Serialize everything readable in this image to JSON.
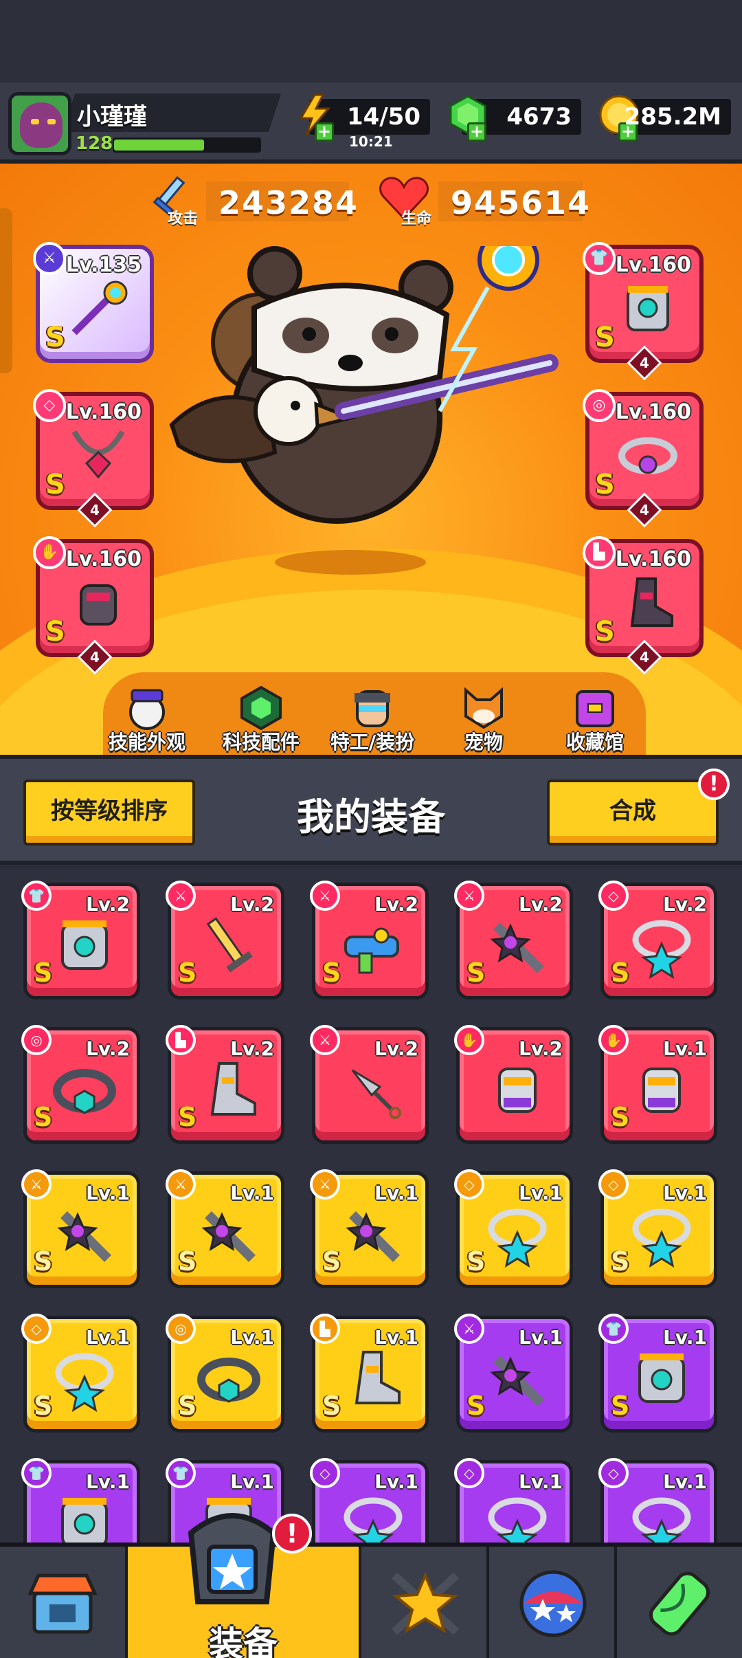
{
  "player": {
    "name": "小瑾瑾",
    "level": "128",
    "xp_fraction": 0.62
  },
  "resources": {
    "energy": "14/50",
    "energy_timer": "10:21",
    "gems": "4673",
    "coins": "285.2M"
  },
  "stats": {
    "attack_label": "攻击",
    "attack_value": "243284",
    "hp_label": "生命",
    "hp_value": "945614"
  },
  "equipped": {
    "left": [
      {
        "level": "Lv.135",
        "grade": "S",
        "stars": null,
        "icon": "weapon-staff-icon"
      },
      {
        "level": "Lv.160",
        "grade": "S",
        "stars": "4",
        "icon": "necklace-icon"
      },
      {
        "level": "Lv.160",
        "grade": "S",
        "stars": "4",
        "icon": "glove-icon"
      }
    ],
    "right": [
      {
        "level": "Lv.160",
        "grade": "S",
        "stars": "4",
        "icon": "armor-icon"
      },
      {
        "level": "Lv.160",
        "grade": "S",
        "stars": "4",
        "icon": "belt-icon"
      },
      {
        "level": "Lv.160",
        "grade": "S",
        "stars": "4",
        "icon": "boot-icon"
      }
    ]
  },
  "hero_menu": [
    {
      "label": "技能外观",
      "icon": "skill-skin-icon"
    },
    {
      "label": "科技配件",
      "icon": "tech-part-icon"
    },
    {
      "label": "特工/装扮",
      "icon": "agent-outfit-icon"
    },
    {
      "label": "宠物",
      "icon": "pet-icon"
    },
    {
      "label": "收藏馆",
      "icon": "collection-icon"
    }
  ],
  "equipment_panel": {
    "sort_label": "按等级排序",
    "title": "我的装备",
    "merge_label": "合成",
    "alert": "!"
  },
  "inventory": [
    {
      "level": "Lv.2",
      "grade": "S",
      "rarity": "red",
      "icon": "armor-icon"
    },
    {
      "level": "Lv.2",
      "grade": "S",
      "rarity": "red",
      "icon": "sword-icon"
    },
    {
      "level": "Lv.2",
      "grade": "S",
      "rarity": "red",
      "icon": "water-gun-icon"
    },
    {
      "level": "Lv.2",
      "grade": "S",
      "rarity": "red",
      "icon": "shuriken-blade-icon"
    },
    {
      "level": "Lv.2",
      "grade": "S",
      "rarity": "red",
      "icon": "necklace-icon"
    },
    {
      "level": "Lv.2",
      "grade": "S",
      "rarity": "red",
      "icon": "belt-icon"
    },
    {
      "level": "Lv.2",
      "grade": "S",
      "rarity": "red",
      "icon": "boot-icon"
    },
    {
      "level": "Lv.2",
      "grade": "",
      "rarity": "red",
      "icon": "kunai-icon"
    },
    {
      "level": "Lv.2",
      "grade": "",
      "rarity": "red",
      "icon": "glove-icon"
    },
    {
      "level": "Lv.1",
      "grade": "S",
      "rarity": "red",
      "icon": "glove-icon"
    },
    {
      "level": "Lv.1",
      "grade": "S",
      "rarity": "yellow",
      "icon": "shuriken-blade-icon"
    },
    {
      "level": "Lv.1",
      "grade": "S",
      "rarity": "yellow",
      "icon": "shuriken-blade-icon"
    },
    {
      "level": "Lv.1",
      "grade": "S",
      "rarity": "yellow",
      "icon": "shuriken-blade-icon"
    },
    {
      "level": "Lv.1",
      "grade": "S",
      "rarity": "yellow",
      "icon": "necklace-icon"
    },
    {
      "level": "Lv.1",
      "grade": "S",
      "rarity": "yellow",
      "icon": "necklace-icon"
    },
    {
      "level": "Lv.1",
      "grade": "S",
      "rarity": "yellow",
      "icon": "necklace-icon"
    },
    {
      "level": "Lv.1",
      "grade": "S",
      "rarity": "yellow",
      "icon": "belt-icon"
    },
    {
      "level": "Lv.1",
      "grade": "S",
      "rarity": "yellow",
      "icon": "boot-icon"
    },
    {
      "level": "Lv.1",
      "grade": "S",
      "rarity": "purple",
      "icon": "shuriken-blade-icon"
    },
    {
      "level": "Lv.1",
      "grade": "S",
      "rarity": "purple",
      "icon": "armor-icon"
    },
    {
      "level": "Lv.1",
      "grade": "",
      "rarity": "purple",
      "icon": "armor-icon"
    },
    {
      "level": "Lv.1",
      "grade": "",
      "rarity": "purple",
      "icon": "armor-icon"
    },
    {
      "level": "Lv.1",
      "grade": "",
      "rarity": "purple",
      "icon": "necklace-icon"
    },
    {
      "level": "Lv.1",
      "grade": "",
      "rarity": "purple",
      "icon": "necklace-icon"
    },
    {
      "level": "Lv.1",
      "grade": "",
      "rarity": "purple",
      "icon": "necklace-icon"
    }
  ],
  "bottom_nav": [
    {
      "label": "",
      "icon": "shop-icon"
    },
    {
      "label": "装备",
      "icon": "equipment-icon",
      "active": true,
      "alert": "!"
    },
    {
      "label": "",
      "icon": "battle-star-icon"
    },
    {
      "label": "",
      "icon": "ball-icon"
    },
    {
      "label": "",
      "icon": "dna-icon"
    }
  ],
  "colors": {
    "red_card": "#ff3f5e",
    "yellow_card": "#ffcf18",
    "purple_card": "#a53cf0",
    "hero_bg": "#fb8f14",
    "accent_button": "#ffcf1f"
  }
}
